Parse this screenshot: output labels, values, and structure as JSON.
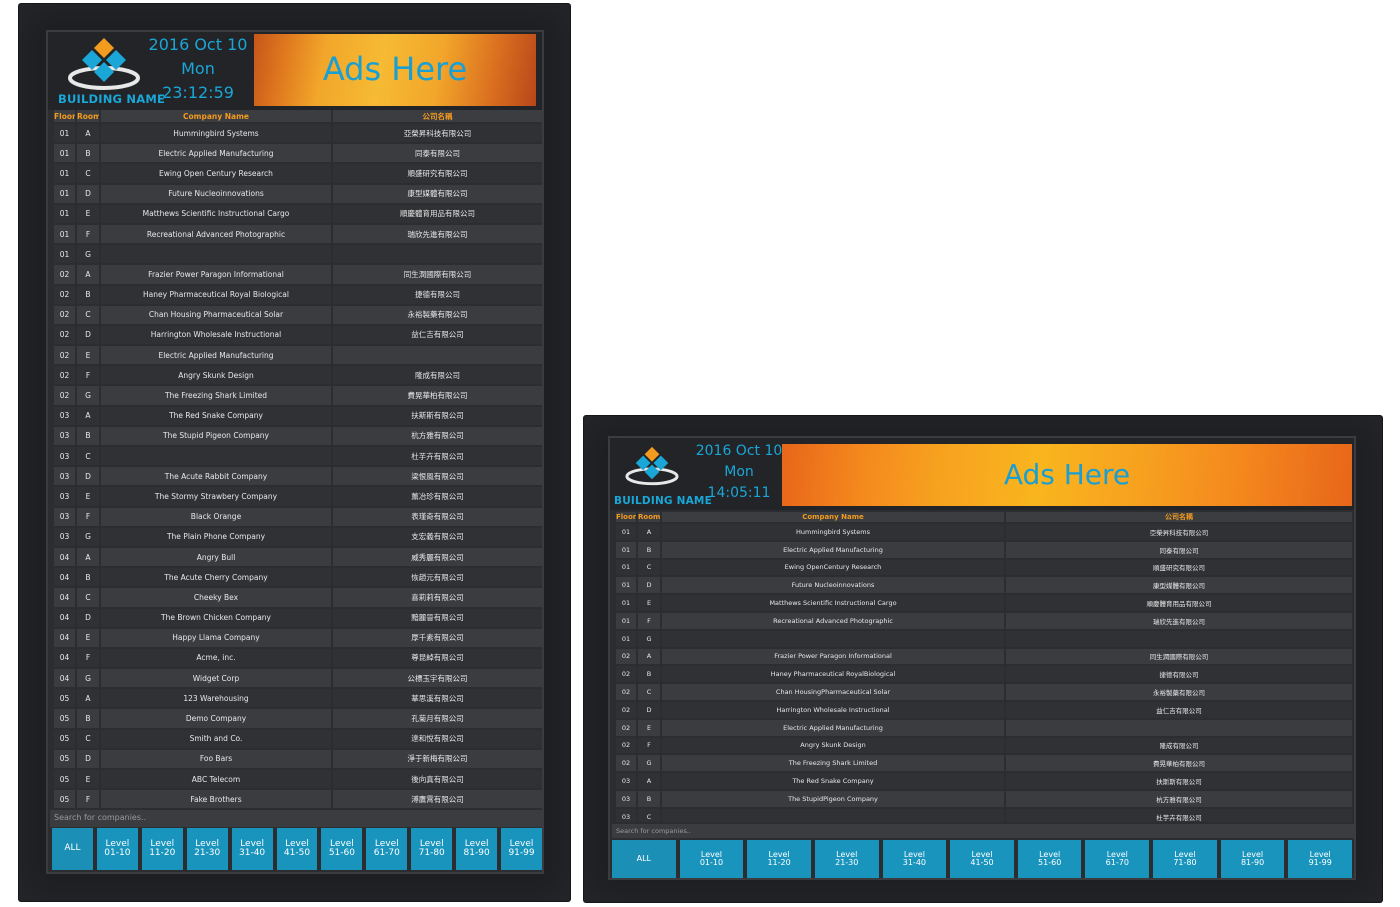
{
  "portrait": {
    "building_name": "BUILDING NAME",
    "date": "2016 Oct 10",
    "weekday": "Mon",
    "time": "23:12:59",
    "ads_text": "Ads Here",
    "headers": {
      "floor": "Floor",
      "room": "Room",
      "company": "Company Name",
      "chinese": "公司名稱"
    },
    "search_placeholder": "Search for companies..",
    "buttons": [
      "ALL",
      "Level\n01-10",
      "Level\n11-20",
      "Level\n21-30",
      "Level\n31-40",
      "Level\n41-50",
      "Level\n51-60",
      "Level\n61-70",
      "Level\n71-80",
      "Level\n81-90",
      "Level\n91-99"
    ],
    "rows": [
      [
        "01",
        "A",
        "Hummingbird Systems",
        "亞榮昇科技有限公司"
      ],
      [
        "01",
        "B",
        "Electric Applied Manufacturing",
        "同泰有限公司"
      ],
      [
        "01",
        "C",
        "Ewing Open Century Research",
        "順盛研究有限公司"
      ],
      [
        "01",
        "D",
        "Future Nucleoinnovations",
        "康型媒體有限公司"
      ],
      [
        "01",
        "E",
        "Matthews Scientific Instructional Cargo",
        "順慶體育用品有限公司"
      ],
      [
        "01",
        "F",
        "Recreational Advanced Photographic",
        "瑞欣先進有限公司"
      ],
      [
        "01",
        "G",
        "",
        ""
      ],
      [
        "02",
        "A",
        "Frazier Power Paragon Informational",
        "同生潤國際有限公司"
      ],
      [
        "02",
        "B",
        "Haney Pharmaceutical Royal Biological",
        "捷德有限公司"
      ],
      [
        "02",
        "C",
        "Chan Housing Pharmaceutical Solar",
        "永裕製藥有限公司"
      ],
      [
        "02",
        "D",
        "Harrington Wholesale Instructional",
        "益仁吉有限公司"
      ],
      [
        "02",
        "E",
        "Electric Applied Manufacturing",
        ""
      ],
      [
        "02",
        "F",
        "Angry Skunk Design",
        "隆成有限公司"
      ],
      [
        "02",
        "G",
        "The Freezing Shark Limited",
        "費晃華柏有限公司"
      ],
      [
        "03",
        "A",
        "The Red Snake Company",
        "扶斯斯有限公司"
      ],
      [
        "03",
        "B",
        "The Stupid Pigeon Company",
        "杭方雅有限公司"
      ],
      [
        "03",
        "C",
        "",
        "杜芋卉有限公司"
      ],
      [
        "03",
        "D",
        "The Acute Rabbit Company",
        "梁恨風有限公司"
      ],
      [
        "03",
        "E",
        "The Stormy Strawbery Company",
        "薰冶珍有限公司"
      ],
      [
        "03",
        "F",
        "Black Orange",
        "表瑾奇有限公司"
      ],
      [
        "03",
        "G",
        "The Plain Phone Company",
        "支宏義有限公司"
      ],
      [
        "04",
        "A",
        "Angry Bull",
        "威秀麗有限公司"
      ],
      [
        "04",
        "B",
        "The Acute Cherry Company",
        "恢趙元有限公司"
      ],
      [
        "04",
        "C",
        "Cheeky Bex",
        "喜莉莉有限公司"
      ],
      [
        "04",
        "D",
        "The Brown Chicken Company",
        "黯麗晉有限公司"
      ],
      [
        "04",
        "E",
        "Happy Llama Company",
        "厚千素有限公司"
      ],
      [
        "04",
        "F",
        "Acme, inc.",
        "尊昆綽有限公司"
      ],
      [
        "04",
        "G",
        "Widget Corp",
        "公標玉宇有限公司"
      ],
      [
        "05",
        "A",
        "123 Warehousing",
        "華思溪有限公司"
      ],
      [
        "05",
        "B",
        "Demo Company",
        "孔菊月有限公司"
      ],
      [
        "05",
        "C",
        "Smith and Co.",
        "達和悅有限公司"
      ],
      [
        "05",
        "D",
        "Foo Bars",
        "淨于新梅有限公司"
      ],
      [
        "05",
        "E",
        "ABC Telecom",
        "後向真有限公司"
      ],
      [
        "05",
        "F",
        "Fake Brothers",
        "溥鷹霄有限公司"
      ]
    ]
  },
  "landscape": {
    "building_name": "BUILDING NAME",
    "date": "2016 Oct 10",
    "weekday": "Mon",
    "time": "14:05:11",
    "ads_text": "Ads Here",
    "headers": {
      "floor": "Floor",
      "room": "Room",
      "company": "Company Name",
      "chinese": "公司名稱"
    },
    "search_placeholder": "Search for companies..",
    "buttons": [
      "ALL",
      "Level\n01-10",
      "Level\n11-20",
      "Level\n21-30",
      "Level\n31-40",
      "Level\n41-50",
      "Level\n51-60",
      "Level\n61-70",
      "Level\n71-80",
      "Level\n81-90",
      "Level\n91-99"
    ],
    "rows": [
      [
        "01",
        "A",
        "Hummingbird Systems",
        "亞榮昇科技有限公司"
      ],
      [
        "01",
        "B",
        "Electric Applied Manufacturing",
        "同泰有限公司"
      ],
      [
        "01",
        "C",
        "Ewing OpenCentury Research",
        "順盛研究有限公司"
      ],
      [
        "01",
        "D",
        "Future Nucleoinnovations",
        "康型媒體有限公司"
      ],
      [
        "01",
        "E",
        "Matthews Scientific Instructional Cargo",
        "順慶體育用品有限公司"
      ],
      [
        "01",
        "F",
        "Recreational Advanced Photographic",
        "瑞欣先進有限公司"
      ],
      [
        "01",
        "G",
        "",
        ""
      ],
      [
        "02",
        "A",
        "Frazier Power Paragon Informational",
        "同生潤國際有限公司"
      ],
      [
        "02",
        "B",
        "Haney Pharmaceutical RoyalBiological",
        "捷德有限公司"
      ],
      [
        "02",
        "C",
        "Chan HousingPharmaceutical Solar",
        "永裕製藥有限公司"
      ],
      [
        "02",
        "D",
        "Harrington Wholesale Instructional",
        "益仁吉有限公司"
      ],
      [
        "02",
        "E",
        "Electric Applied Manufacturing",
        ""
      ],
      [
        "02",
        "F",
        "Angry Skunk Design",
        "隆成有限公司"
      ],
      [
        "02",
        "G",
        "The Freezing Shark Limited",
        "費晃華柏有限公司"
      ],
      [
        "03",
        "A",
        "The Red Snake Company",
        "扶斯斯有限公司"
      ],
      [
        "03",
        "B",
        "The StupidPigeon Company",
        "杭方雅有限公司"
      ],
      [
        "03",
        "C",
        "",
        "杜芋卉有限公司"
      ]
    ]
  },
  "colors": {
    "accent": "#1994bd",
    "header_text": "#f39b1e",
    "brand": "#1aa6d6"
  }
}
